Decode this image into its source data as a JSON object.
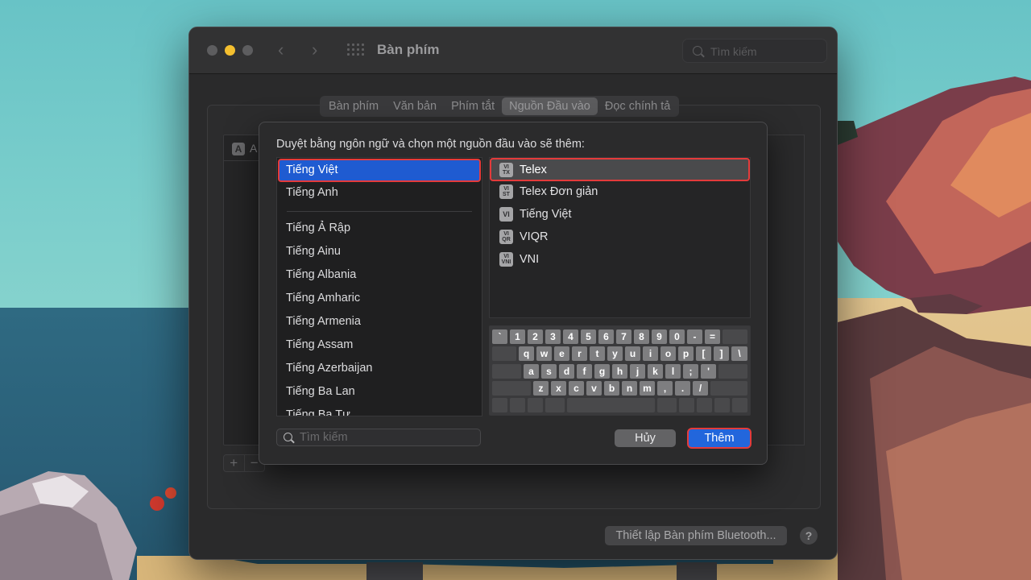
{
  "window": {
    "title": "Bàn phím",
    "search_placeholder": "Tìm kiếm",
    "tabs": [
      {
        "label": "Bàn phím",
        "active": false
      },
      {
        "label": "Văn bản",
        "active": false
      },
      {
        "label": "Phím tắt",
        "active": false
      },
      {
        "label": "Nguồn Đầu vào",
        "active": true
      },
      {
        "label": "Đọc chính tả",
        "active": false
      }
    ],
    "background_list_glyph": "A",
    "background_list_label": "A",
    "plus_label": "+",
    "minus_label": "−",
    "bluetooth_button": "Thiết lập Bàn phím Bluetooth...",
    "help_button": "?"
  },
  "sheet": {
    "prompt": "Duyệt bằng ngôn ngữ và chọn một nguồn đầu vào sẽ thêm:",
    "languages_top": [
      "Tiếng Việt",
      "Tiếng Anh"
    ],
    "languages": [
      "Tiếng Ả Rập",
      "Tiếng Ainu",
      "Tiếng Albania",
      "Tiếng Amharic",
      "Tiếng Armenia",
      "Tiếng Assam",
      "Tiếng Azerbaijan",
      "Tiếng Ba Lan",
      "Tiếng Ba Tư"
    ],
    "selected_language": "Tiếng Việt",
    "sources": [
      {
        "label": "Telex",
        "icon_top": "VI",
        "icon_bottom": "TX",
        "selected": true
      },
      {
        "label": "Telex Đơn giản",
        "icon_top": "VI",
        "icon_bottom": "ST",
        "selected": false
      },
      {
        "label": "Tiếng Việt",
        "icon_top": "VI",
        "icon_bottom": "",
        "selected": false
      },
      {
        "label": "VIQR",
        "icon_top": "VI",
        "icon_bottom": "QR",
        "selected": false
      },
      {
        "label": "VNI",
        "icon_top": "VI",
        "icon_bottom": "VNI",
        "selected": false
      }
    ],
    "keyboard_rows": [
      [
        "`",
        "1",
        "2",
        "3",
        "4",
        "5",
        "6",
        "7",
        "8",
        "9",
        "0",
        "-",
        "="
      ],
      [
        "q",
        "w",
        "e",
        "r",
        "t",
        "y",
        "u",
        "i",
        "o",
        "p",
        "[",
        "]",
        "\\"
      ],
      [
        "a",
        "s",
        "d",
        "f",
        "g",
        "h",
        "j",
        "k",
        "l",
        ";",
        "'"
      ],
      [
        "z",
        "x",
        "c",
        "v",
        "b",
        "n",
        "m",
        ",",
        ".",
        "/"
      ]
    ],
    "search_placeholder": "Tìm kiếm",
    "search_value": "",
    "cancel_button": "Hủy",
    "add_button": "Thêm"
  },
  "colors": {
    "accent_blue": "#1f5bd1",
    "highlight_red": "#e43b3b",
    "minimize_yellow": "#f4bf2f"
  }
}
